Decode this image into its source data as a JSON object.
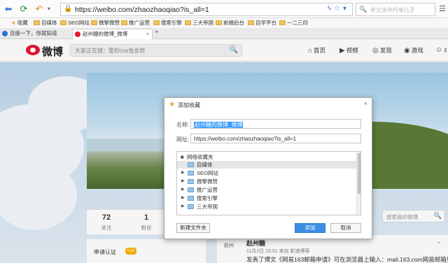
{
  "browser": {
    "url": "https://weibo.com/zhaozhaoqiao?is_all=1",
    "search_placeholder": "老父水中托举儿子",
    "bookmarks": [
      "收藏",
      "自媒体",
      "SEO网站",
      "微擎微赞",
      "推广运营",
      "搜索引擎",
      "三大帝国",
      "前端后台",
      "自学平台",
      "一二三四"
    ],
    "tabs": [
      {
        "title": "百度一下，你就知道",
        "active": false
      },
      {
        "title": "赵州糖的微博_微博",
        "active": true
      }
    ]
  },
  "weibo": {
    "logo": "微博",
    "search_placeholder": "大家正在搜：雷豹cos兔女郎",
    "nav": [
      "首页",
      "视频",
      "发现",
      "游戏",
      "z"
    ],
    "stats": [
      {
        "value": "72",
        "label": "关注"
      },
      {
        "value": "1",
        "label": "粉丝"
      }
    ],
    "auth_label": "申请认证",
    "auth_badge": "Lv4",
    "profile_search_placeholder": "搜索我的微博",
    "feed": {
      "logo_text": "赵州",
      "name": "赵州糖",
      "meta": "11月2日 15:51 来自 新浪博客",
      "text": "发表了博文《网易163邮箱申请》可在浏览器上输入：mail.163.com网易邮箱登录"
    }
  },
  "dialog": {
    "title": "添加收藏",
    "name_label": "名称:",
    "name_value": "赵州糖的微博_微博",
    "url_label": "网址:",
    "url_value": "https://weibo.com/zhaozhaoqiao?is_all=1",
    "tree_root": "网络收藏夹",
    "folders": [
      "自媒体",
      "SEO网站",
      "微擎微赞",
      "推广运营",
      "搜索引擎",
      "三大帝国"
    ],
    "new_folder_label": "新建文件夹",
    "add_label": "添加",
    "cancel_label": "取消"
  },
  "colors": {
    "weibo_red": "#e6162d",
    "primary_button": "#3b8ee3",
    "selection": "#3399ff"
  }
}
